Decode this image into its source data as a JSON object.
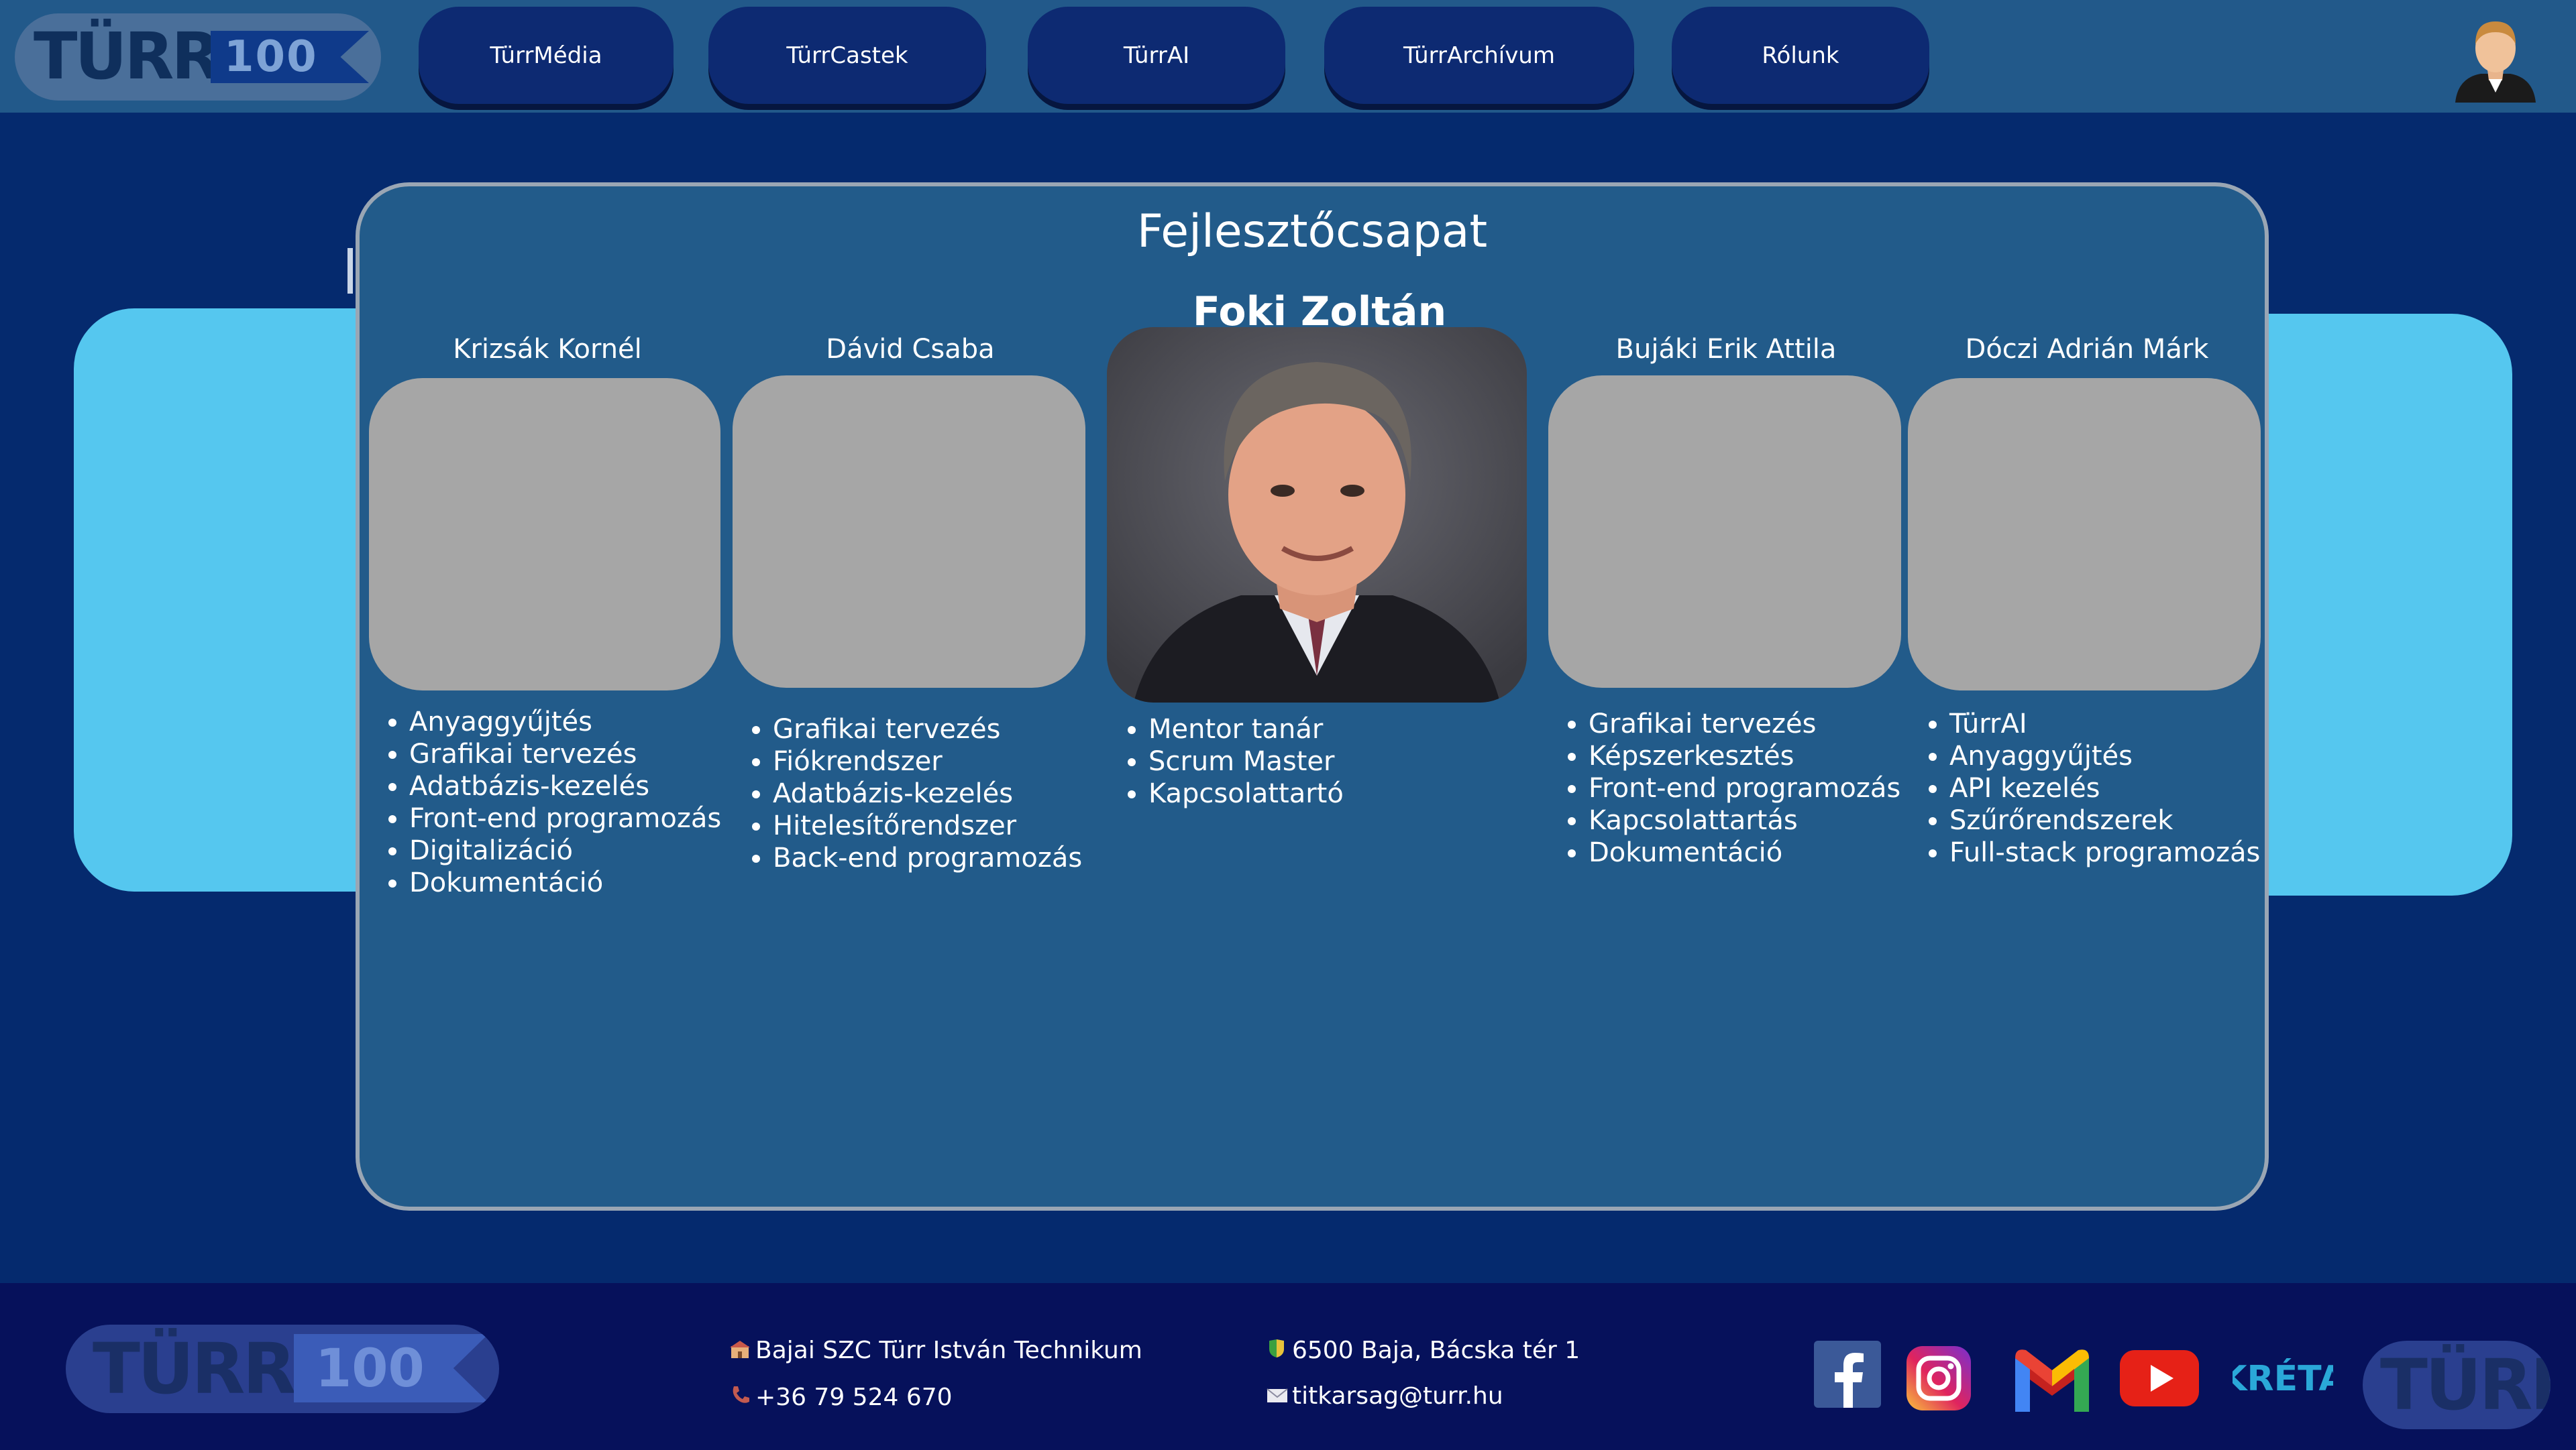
{
  "header": {
    "logo_text": "TÜRR",
    "logo_number": "100",
    "nav": [
      {
        "label": "TürrMédia"
      },
      {
        "label": "TürrCastek"
      },
      {
        "label": "TürrAI"
      },
      {
        "label": "TürrArchívum"
      },
      {
        "label": "Rólunk"
      }
    ]
  },
  "panel": {
    "title": "Fejlesztőcsapat",
    "members": [
      {
        "name": "Krizsák Kornél",
        "skills": [
          "Anyaggyűjtés",
          "Grafikai tervezés",
          "Adatbázis-kezelés",
          "Front-end programozás",
          "Digitalizáció",
          "Dokumentáció"
        ]
      },
      {
        "name": "Dávid Csaba",
        "skills": [
          "Grafikai tervezés",
          "Fiókrendszer",
          "Adatbázis-kezelés",
          "Hitelesítőrendszer",
          "Back-end programozás"
        ]
      },
      {
        "name": "Foki Zoltán",
        "skills": [
          "Mentor tanár",
          "Scrum Master",
          "Kapcsolattartó"
        ]
      },
      {
        "name": "Bujáki Erik Attila",
        "skills": [
          "Grafikai tervezés",
          "Képszerkesztés",
          "Front-end programozás",
          "Kapcsolattartás",
          "Dokumentáció"
        ]
      },
      {
        "name": "Dóczi Adrián Márk",
        "skills": [
          "TürrAI",
          "Anyaggyűjtés",
          "API kezelés",
          "Szűrőrendszerek",
          "Full-stack programozás"
        ]
      }
    ]
  },
  "footer": {
    "logo_text": "TÜRR",
    "logo_number": "100",
    "school": "Bajai SZC Türr István Technikum",
    "phone": "+36 79 524 670",
    "address": "6500 Baja, Bácska tér 1",
    "email": "titkarsag@turr.hu",
    "kreta": "KRÉTA",
    "logo2_text": "TÜRR"
  },
  "icons": [
    "facebook-icon",
    "instagram-icon",
    "gmail-icon",
    "youtube-icon",
    "kreta-icon",
    "user-avatar-icon",
    "school-icon",
    "phone-icon",
    "location-icon",
    "mail-icon"
  ],
  "colors": {
    "background": "#052a6e",
    "header": "#22598a",
    "nav_button": "#0d2a72",
    "panel": "#225b8a",
    "light_bar": "#55c7ef",
    "footer": "#06115b",
    "placeholder": "#a6a6a6"
  }
}
